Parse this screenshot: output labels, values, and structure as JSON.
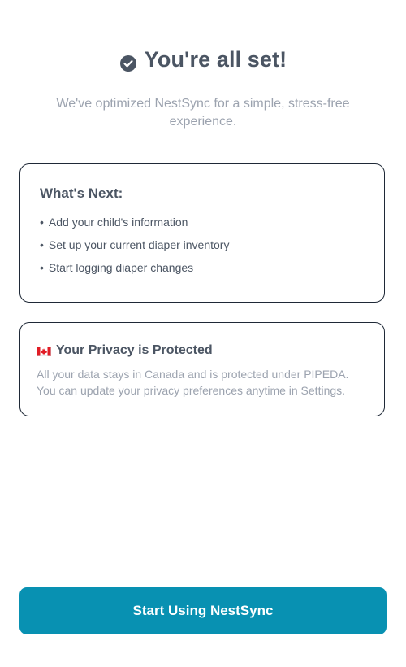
{
  "header": {
    "icon": "check-circle-icon",
    "title": "You're all set!",
    "subtitle": "We've optimized NestSync for a simple, stress-free experience."
  },
  "next_steps": {
    "title": "What's Next:",
    "bullet": "•",
    "items": [
      "Add your child's information",
      "Set up your current diaper inventory",
      "Start logging diaper changes"
    ]
  },
  "privacy": {
    "icon": "canada-flag-icon",
    "title": "Your Privacy is Protected",
    "text": "All your data stays in Canada and is protected under PIPEDA. You can update your privacy preferences anytime in Settings."
  },
  "cta": {
    "label": "Start Using NestSync"
  },
  "colors": {
    "primary": "#0891b2",
    "heading": "#4b5563",
    "muted": "#9ca3af"
  }
}
